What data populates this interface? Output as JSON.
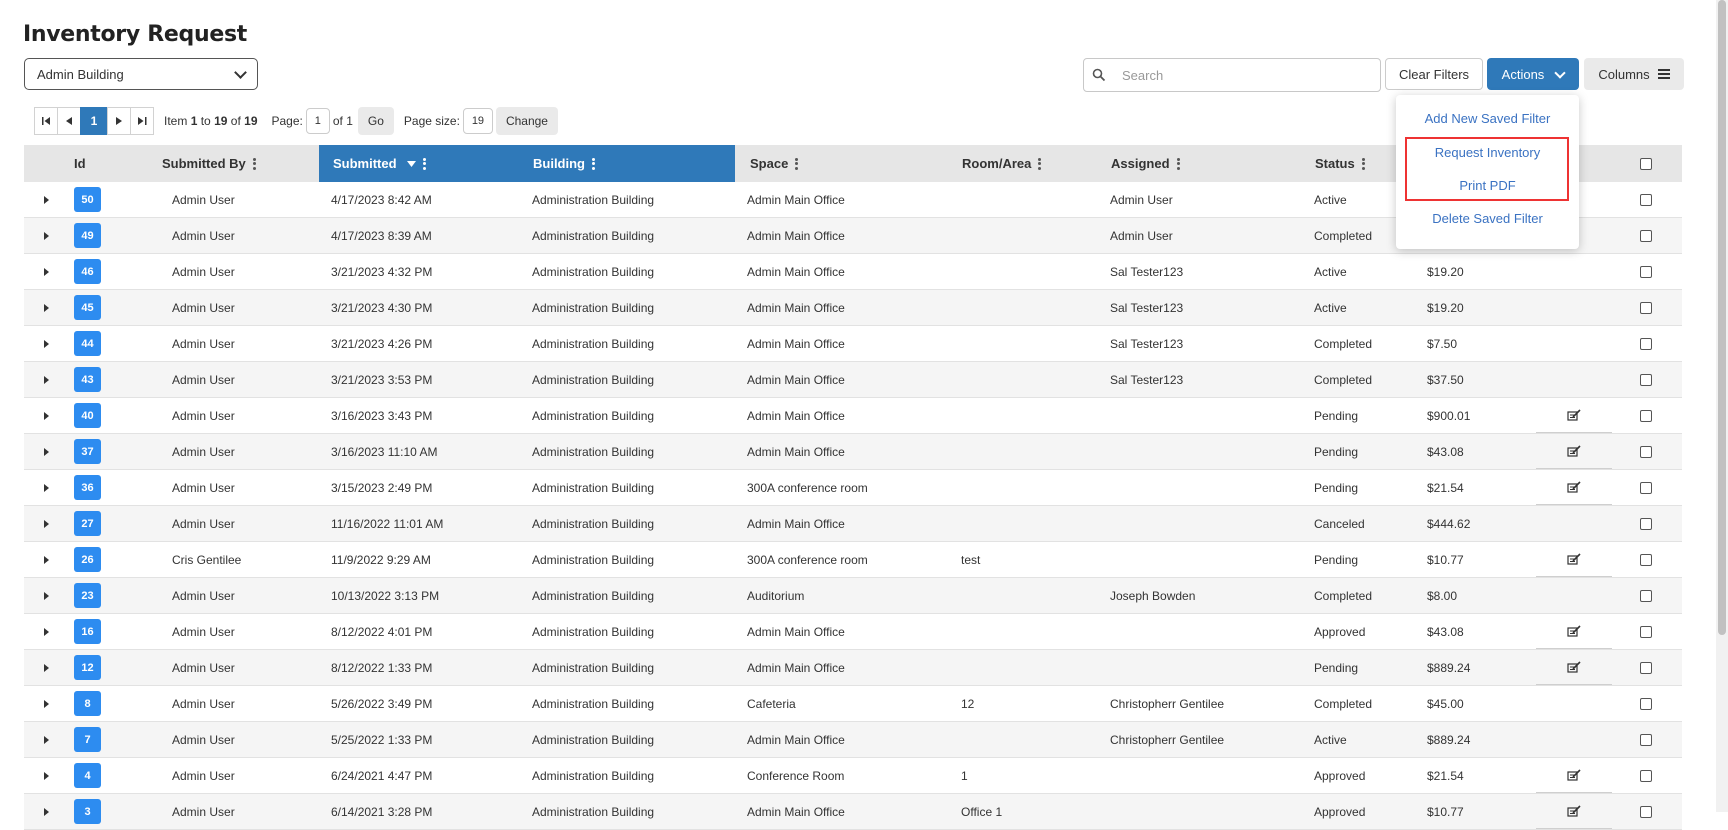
{
  "page": {
    "title": "Inventory Request"
  },
  "filters": {
    "building_select": "Admin Building",
    "search_placeholder": "Search",
    "clear_label": "Clear Filters",
    "actions_label": "Actions",
    "columns_label": "Columns"
  },
  "pager": {
    "current_page": "1",
    "item_prefix": "Item",
    "item_from": "1",
    "item_to_label": "to",
    "item_to": "19",
    "item_of_label": "of",
    "item_total": "19",
    "page_label": "Page:",
    "page_value": "1",
    "of_pages": "of 1",
    "go_label": "Go",
    "page_size_label": "Page size:",
    "page_size_value": "19",
    "change_label": "Change"
  },
  "actions_menu": {
    "items": [
      "Add New Saved Filter",
      "Request Inventory",
      "Print PDF",
      "Delete Saved Filter"
    ]
  },
  "grid": {
    "columns": [
      "Id",
      "Submitted By",
      "Submitted",
      "Building",
      "Space",
      "Room/Area",
      "Assigned",
      "Status"
    ],
    "rows": [
      {
        "id": "50",
        "by": "Admin User",
        "submitted": "4/17/2023 8:42 AM",
        "building": "Administration Building",
        "space": "Admin Main Office",
        "room": "",
        "assigned": "Admin User",
        "status": "Active",
        "total": "",
        "edit": false
      },
      {
        "id": "49",
        "by": "Admin User",
        "submitted": "4/17/2023 8:39 AM",
        "building": "Administration Building",
        "space": "Admin Main Office",
        "room": "",
        "assigned": "Admin User",
        "status": "Completed",
        "total": "",
        "edit": false
      },
      {
        "id": "46",
        "by": "Admin User",
        "submitted": "3/21/2023 4:32 PM",
        "building": "Administration Building",
        "space": "Admin Main Office",
        "room": "",
        "assigned": "Sal Tester123",
        "status": "Active",
        "total": "$19.20",
        "edit": false
      },
      {
        "id": "45",
        "by": "Admin User",
        "submitted": "3/21/2023 4:30 PM",
        "building": "Administration Building",
        "space": "Admin Main Office",
        "room": "",
        "assigned": "Sal Tester123",
        "status": "Active",
        "total": "$19.20",
        "edit": false
      },
      {
        "id": "44",
        "by": "Admin User",
        "submitted": "3/21/2023 4:26 PM",
        "building": "Administration Building",
        "space": "Admin Main Office",
        "room": "",
        "assigned": "Sal Tester123",
        "status": "Completed",
        "total": "$7.50",
        "edit": false
      },
      {
        "id": "43",
        "by": "Admin User",
        "submitted": "3/21/2023 3:53 PM",
        "building": "Administration Building",
        "space": "Admin Main Office",
        "room": "",
        "assigned": "Sal Tester123",
        "status": "Completed",
        "total": "$37.50",
        "edit": false
      },
      {
        "id": "40",
        "by": "Admin User",
        "submitted": "3/16/2023 3:43 PM",
        "building": "Administration Building",
        "space": "Admin Main Office",
        "room": "",
        "assigned": "",
        "status": "Pending",
        "total": "$900.01",
        "edit": true
      },
      {
        "id": "37",
        "by": "Admin User",
        "submitted": "3/16/2023 11:10 AM",
        "building": "Administration Building",
        "space": "Admin Main Office",
        "room": "",
        "assigned": "",
        "status": "Pending",
        "total": "$43.08",
        "edit": true
      },
      {
        "id": "36",
        "by": "Admin User",
        "submitted": "3/15/2023 2:49 PM",
        "building": "Administration Building",
        "space": "300A conference room",
        "room": "",
        "assigned": "",
        "status": "Pending",
        "total": "$21.54",
        "edit": true
      },
      {
        "id": "27",
        "by": "Admin User",
        "submitted": "11/16/2022 11:01 AM",
        "building": "Administration Building",
        "space": "Admin Main Office",
        "room": "",
        "assigned": "",
        "status": "Canceled",
        "total": "$444.62",
        "edit": false
      },
      {
        "id": "26",
        "by": "Cris Gentilee",
        "submitted": "11/9/2022 9:29 AM",
        "building": "Administration Building",
        "space": "300A conference room",
        "room": "test",
        "assigned": "",
        "status": "Pending",
        "total": "$10.77",
        "edit": true
      },
      {
        "id": "23",
        "by": "Admin User",
        "submitted": "10/13/2022 3:13 PM",
        "building": "Administration Building",
        "space": "Auditorium",
        "room": "",
        "assigned": "Joseph Bowden",
        "status": "Completed",
        "total": "$8.00",
        "edit": false
      },
      {
        "id": "16",
        "by": "Admin User",
        "submitted": "8/12/2022 4:01 PM",
        "building": "Administration Building",
        "space": "Admin Main Office",
        "room": "",
        "assigned": "",
        "status": "Approved",
        "total": "$43.08",
        "edit": true
      },
      {
        "id": "12",
        "by": "Admin User",
        "submitted": "8/12/2022 1:33 PM",
        "building": "Administration Building",
        "space": "Admin Main Office",
        "room": "",
        "assigned": "",
        "status": "Pending",
        "total": "$889.24",
        "edit": true
      },
      {
        "id": "8",
        "by": "Admin User",
        "submitted": "5/26/2022 3:49 PM",
        "building": "Administration Building",
        "space": "Cafeteria",
        "room": "12",
        "assigned": "Christopherr Gentilee",
        "status": "Completed",
        "total": "$45.00",
        "edit": false
      },
      {
        "id": "7",
        "by": "Admin User",
        "submitted": "5/25/2022 1:33 PM",
        "building": "Administration Building",
        "space": "Admin Main Office",
        "room": "",
        "assigned": "Christopherr Gentilee",
        "status": "Active",
        "total": "$889.24",
        "edit": false
      },
      {
        "id": "4",
        "by": "Admin User",
        "submitted": "6/24/2021 4:47 PM",
        "building": "Administration Building",
        "space": "Conference Room",
        "room": "1",
        "assigned": "",
        "status": "Approved",
        "total": "$21.54",
        "edit": true
      },
      {
        "id": "3",
        "by": "Admin User",
        "submitted": "6/14/2021 3:28 PM",
        "building": "Administration Building",
        "space": "Admin Main Office",
        "room": "Office 1",
        "assigned": "",
        "status": "Approved",
        "total": "$10.77",
        "edit": true
      }
    ]
  },
  "icons": {
    "search": "search-icon",
    "actions_chevron": "chevron-down-icon",
    "columns": "hamburger-icon",
    "edit": "edit-icon",
    "sort": "sort-desc-icon"
  },
  "colors": {
    "primary": "#2f79b9",
    "id_badge": "#2d8cf0",
    "highlight": "#ee3333",
    "menu_link": "#3a72c2"
  }
}
